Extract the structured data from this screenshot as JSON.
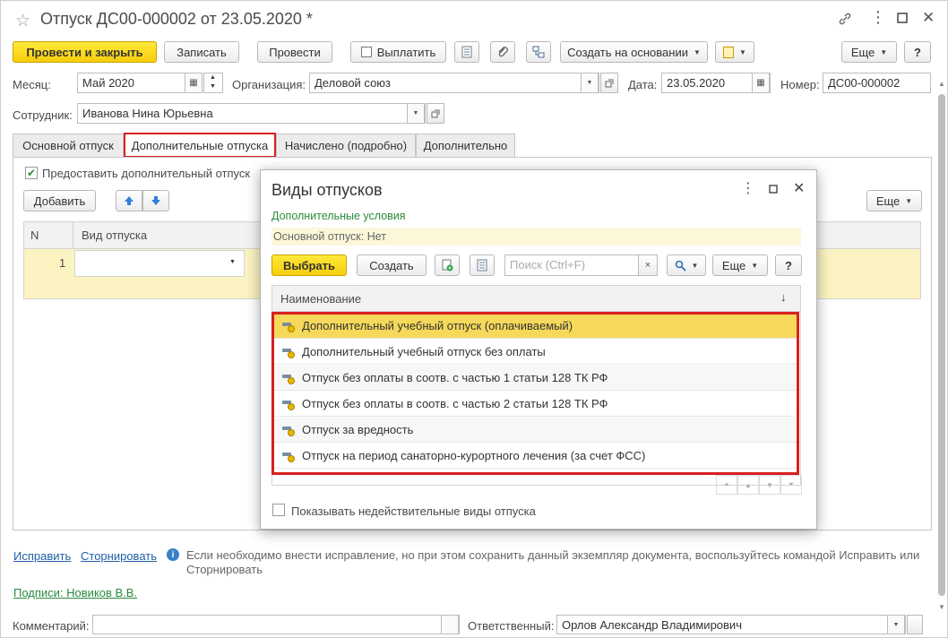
{
  "window": {
    "title": "Отпуск ДС00-000002 от 23.05.2020 *"
  },
  "toolbar": {
    "post_close": "Провести и закрыть",
    "save": "Записать",
    "post": "Провести",
    "pay": "Выплатить",
    "create_based": "Создать на основании",
    "more": "Еще",
    "help": "?"
  },
  "fields": {
    "month_label": "Месяц:",
    "month_value": "Май 2020",
    "org_label": "Организация:",
    "org_value": "Деловой союз",
    "date_label": "Дата:",
    "date_value": "23.05.2020",
    "number_label": "Номер:",
    "number_value": "ДС00-000002",
    "employee_label": "Сотрудник:",
    "employee_value": "Иванова Нина Юрьевна"
  },
  "tabs": [
    "Основной отпуск",
    "Дополнительные отпуска",
    "Начислено (подробно)",
    "Дополнительно"
  ],
  "tab_content": {
    "provide_checkbox": "Предоставить дополнительный отпуск",
    "add_button": "Добавить",
    "more_button": "Еще",
    "col_n": "N",
    "col_type": "Вид отпуска",
    "row_n": "1"
  },
  "footer": {
    "fix_link": "Исправить",
    "storno_link": "Сторнировать",
    "info": "Если необходимо внести исправление, но при этом сохранить данный экземпляр документа, воспользуйтесь командой Исправить или Сторнировать",
    "signatures_link": "Подписи: Новиков В.В.",
    "comment_label": "Комментарий:",
    "responsible_label": "Ответственный:",
    "responsible_value": "Орлов Александр Владимирович"
  },
  "dialog": {
    "title": "Виды отпусков",
    "additional_conditions": "Дополнительные условия",
    "main_vacation_filter": "Основной отпуск: Нет",
    "select_button": "Выбрать",
    "create_button": "Создать",
    "search_placeholder": "Поиск (Ctrl+F)",
    "more_button": "Еще",
    "help_button": "?",
    "column_name": "Наименование",
    "items": [
      "Дополнительный учебный отпуск (оплачиваемый)",
      "Дополнительный учебный отпуск без оплаты",
      "Отпуск без оплаты в соотв. с частью 1 статьи 128 ТК РФ",
      "Отпуск без оплаты в соотв. с частью 2 статьи 128 ТК РФ",
      "Отпуск за вредность",
      "Отпуск на период санаторно-курортного лечения (за счет ФСС)"
    ],
    "show_invalid_checkbox": "Показывать недействительные виды отпуска"
  },
  "colors": {
    "accent_yellow": "#f7cd0b",
    "highlight_red": "#d8201e",
    "link_blue": "#1f5fa8",
    "link_green": "#2b8a3b"
  }
}
